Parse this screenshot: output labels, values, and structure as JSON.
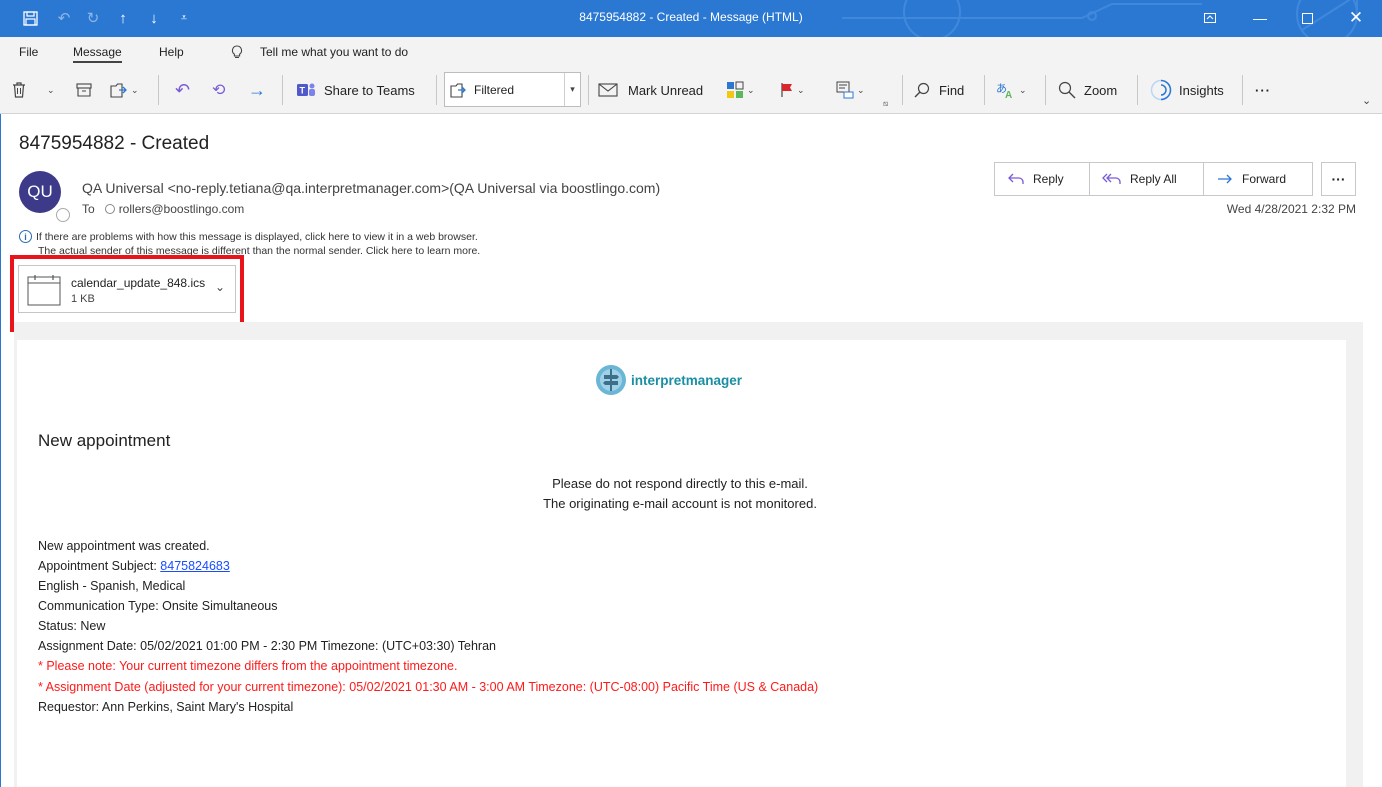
{
  "window": {
    "title": "8475954882 - Created  -  Message (HTML)",
    "controls": [
      "restore-ribbon",
      "minimize",
      "maximize",
      "close"
    ]
  },
  "menu": {
    "file": "File",
    "message": "Message",
    "help": "Help",
    "tell_me": "Tell me what you want to do"
  },
  "ribbon": {
    "share_to_teams": "Share to Teams",
    "filter_value": "Filtered",
    "mark_unread": "Mark Unread",
    "find": "Find",
    "zoom": "Zoom",
    "insights": "Insights",
    "more": "···"
  },
  "message": {
    "subject": "8475954882 - Created",
    "avatar_initials": "QU",
    "from": "QA Universal <no-reply.tetiana@qa.interpretmanager.com>(QA Universal via boostlingo.com)",
    "to_label": "To",
    "to_value": "rollers@boostlingo.com",
    "info_line1": "If there are problems with how this message is displayed, click here to view it in a web browser.",
    "info_line2": "The actual sender of this message is different than the normal sender. Click here to learn more.",
    "date": "Wed 4/28/2021 2:32 PM",
    "actions": {
      "reply": "Reply",
      "reply_all": "Reply All",
      "forward": "Forward",
      "more": "···"
    },
    "attachment": {
      "name": "calendar_update_848.ics",
      "size": "1 KB"
    }
  },
  "body": {
    "logo_text": "interpretmanager",
    "heading": "New appointment",
    "note1": "Please do not respond directly to this e-mail.",
    "note2": "The originating e-mail account is not monitored.",
    "created": "New appointment was created.",
    "subject_label": "Appointment Subject: ",
    "subject_link": "8475824683",
    "languages": "English - Spanish, Medical",
    "communication": "Communication Type: Onsite Simultaneous",
    "status": "Status: New",
    "assignment": "Assignment Date: 05/02/2021 01:00 PM - 2:30 PM Timezone: (UTC+03:30) Tehran",
    "tz_note": "* Please note: Your current timezone differs from the appointment timezone.",
    "adjusted": "* Assignment Date (adjusted for your current timezone): 05/02/2021 01:30 AM - 3:00 AM Timezone: (UTC-08:00) Pacific Time (US & Canada)",
    "requestor": "Requestor: Ann Perkins, Saint Mary's Hospital"
  },
  "colors": {
    "titlebar": "#2b78d3",
    "highlight_box": "#e8141a",
    "warning_text": "#ff1a1a",
    "link": "#1a4cff",
    "avatar_bg": "#3e3a8a",
    "logo_teal": "#1a8ea3"
  }
}
